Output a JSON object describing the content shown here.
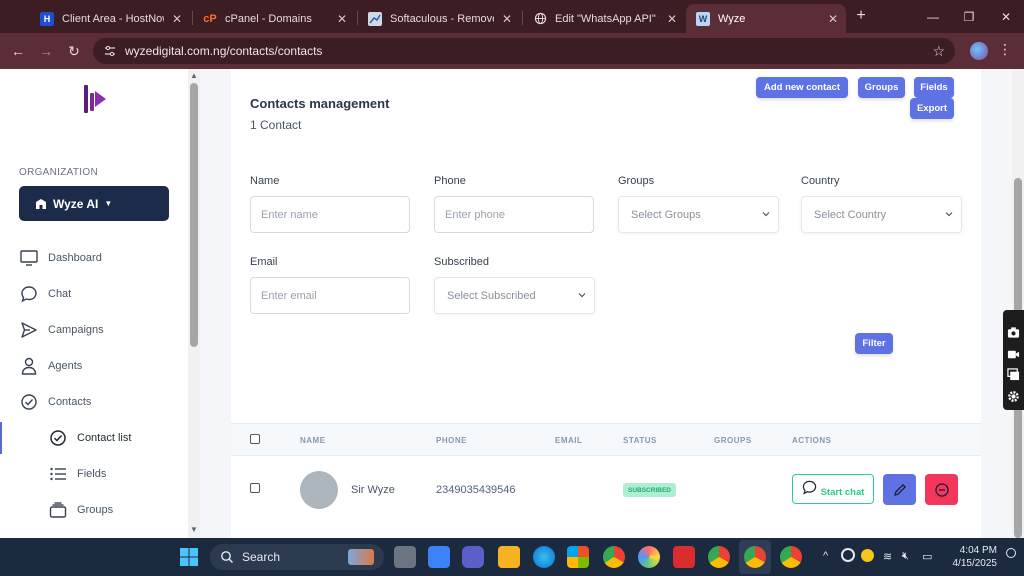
{
  "browser": {
    "tabs": [
      {
        "title": "Client Area - HostNowNow",
        "favicon": "hostnownow-icon"
      },
      {
        "title": "cPanel - Domains",
        "favicon": "cpanel-icon"
      },
      {
        "title": "Softaculous - Remove",
        "favicon": "softaculous-icon"
      },
      {
        "title": "Edit \"WhatsApp API\" with",
        "favicon": "globe-icon"
      },
      {
        "title": "Wyze",
        "favicon": "wyze-icon"
      }
    ],
    "url": "wyzedigital.com.ng/contacts/contacts"
  },
  "sidebar": {
    "org_label": "ORGANIZATION",
    "org_name": "Wyze AI",
    "items": [
      {
        "label": "Dashboard",
        "icon": "monitor-icon"
      },
      {
        "label": "Chat",
        "icon": "chat-bubble-icon"
      },
      {
        "label": "Campaigns",
        "icon": "send-icon"
      },
      {
        "label": "Agents",
        "icon": "user-icon"
      },
      {
        "label": "Contacts",
        "icon": "check-circle-icon"
      },
      {
        "label": "Contact list",
        "icon": "check-circle-icon"
      },
      {
        "label": "Fields",
        "icon": "list-icon"
      },
      {
        "label": "Groups",
        "icon": "stack-icon"
      }
    ]
  },
  "main": {
    "title": "Contacts management",
    "count": "1 Contact",
    "buttons": {
      "add": "Add new contact",
      "groups": "Groups",
      "fields": "Fields",
      "export": "Export",
      "filter": "Filter"
    },
    "filters": {
      "name": {
        "label": "Name",
        "placeholder": "Enter name"
      },
      "phone": {
        "label": "Phone",
        "placeholder": "Enter phone"
      },
      "groups": {
        "label": "Groups",
        "value": "Select Groups"
      },
      "country": {
        "label": "Country",
        "value": "Select Country"
      },
      "email": {
        "label": "Email",
        "placeholder": "Enter email"
      },
      "subscribed": {
        "label": "Subscribed",
        "value": "Select Subscribed"
      }
    },
    "table": {
      "headers": [
        "NAME",
        "PHONE",
        "EMAIL",
        "STATUS",
        "GROUPS",
        "ACTIONS"
      ],
      "rows": [
        {
          "name": "Sir Wyze",
          "phone": "2349035439546",
          "email": "",
          "status": "SUBSCRIBED",
          "groups": "",
          "action_chat": "Start chat"
        }
      ]
    }
  },
  "taskbar": {
    "search": "Search",
    "time": "4:04 PM",
    "date": "4/15/2025"
  },
  "colors": {
    "primary": "#5e72e4",
    "success": "#2dce89",
    "danger": "#f5365c",
    "org_button": "#1d2b4a",
    "browser_frame": "#5b2d36"
  }
}
